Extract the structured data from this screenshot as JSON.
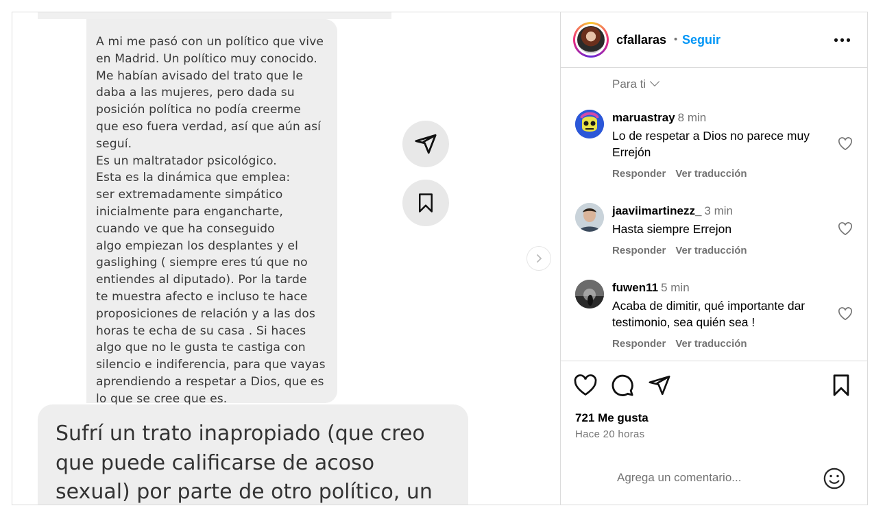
{
  "media": {
    "screenshot_text_1": [
      "A mi me pasó con un político que vive",
      "en Madrid. Un político muy conocido.",
      "Me habían avisado del trato que le",
      "daba a las mujeres, pero dada su",
      "posición política no podía creerme",
      "que eso fuera verdad, así que aún así",
      "seguí.",
      "Es un maltratador psicológico.",
      "Esta es la dinámica que emplea:",
      "ser extremadamente simpático",
      "inicialmente para engancharte,",
      "cuando ve que ha conseguido",
      "algo empiezan los desplantes y el",
      "gaslighing ( siempre eres tú que no",
      "entiendes al diputado). Por la tarde",
      "te muestra afecto e incluso te hace",
      "proposiciones de relación y a las dos",
      "horas te echa de su casa . Si haces",
      "algo que no le gusta te castiga con",
      "silencio e indiferencia, para que vayas",
      "aprendiendo a respetar a Dios, que es",
      "lo que se cree que es."
    ],
    "screenshot_text_2": [
      "Sufrí un trato inapropiado (que creo",
      "que puede calificarse de acoso",
      "sexual) por parte de otro político, un"
    ]
  },
  "header": {
    "username": "cfallaras",
    "separator": "•",
    "follow_label": "Seguir"
  },
  "filter": {
    "label": "Para ti"
  },
  "comments": [
    {
      "user": "maruastray",
      "time": "8 min",
      "text": "Lo de respetar a Dios no parece muy Errejón",
      "reply": "Responder",
      "translate": "Ver traducción"
    },
    {
      "user": "jaaviimartinezz_",
      "time": "3 min",
      "text": "Hasta siempre Errejon",
      "reply": "Responder",
      "translate": "Ver traducción"
    },
    {
      "user": "fuwen11",
      "time": "5 min",
      "text": "Acaba de dimitir, qué importante dar testimonio, sea quién sea !",
      "reply": "Responder",
      "translate": "Ver traducción"
    }
  ],
  "stats": {
    "likes": "721 Me gusta",
    "posted": "Hace 20 horas"
  },
  "add_comment": {
    "placeholder": "Agrega un comentario..."
  },
  "colors": {
    "link_blue": "#0095f6",
    "muted": "#737373",
    "border": "#dbdbdb"
  }
}
